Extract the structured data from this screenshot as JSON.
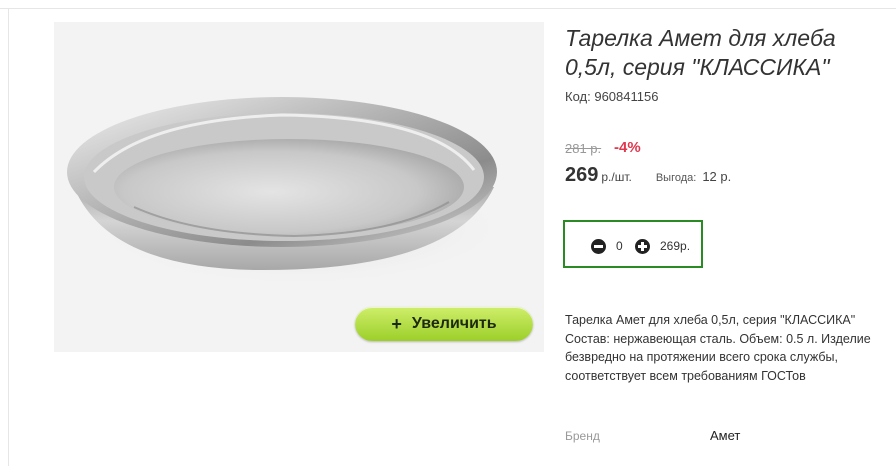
{
  "product": {
    "title": "Тарелка Амет для хлеба 0,5л, серия \"КЛАССИКА\"",
    "code_label": "Код:",
    "code_value": "960841156",
    "description": "Тарелка Амет для хлеба 0,5л, серия \"КЛАССИКА\" Состав: нержавеющая сталь. Объем: 0.5 л. Изделие безвредно на протяжении всего срока службы, соответствует всем требованиям ГОСТов"
  },
  "gallery": {
    "zoom_label": "Увеличить",
    "zoom_icon": "plus-icon"
  },
  "pricing": {
    "old_price": "281 р.",
    "discount": "-4%",
    "price": "269",
    "unit": "р./шт.",
    "savings_label": "Выгода:",
    "savings_value": "12 р."
  },
  "cart": {
    "quantity": "0",
    "total": "269р.",
    "minus_icon": "minus-circle-icon",
    "plus_icon": "plus-circle-icon",
    "border_color": "#2a8a24"
  },
  "attributes": {
    "brand_label": "Бренд",
    "brand_value": "Амет"
  },
  "colors": {
    "discount": "#e0384f",
    "zoom_button": "#b4e04a"
  }
}
